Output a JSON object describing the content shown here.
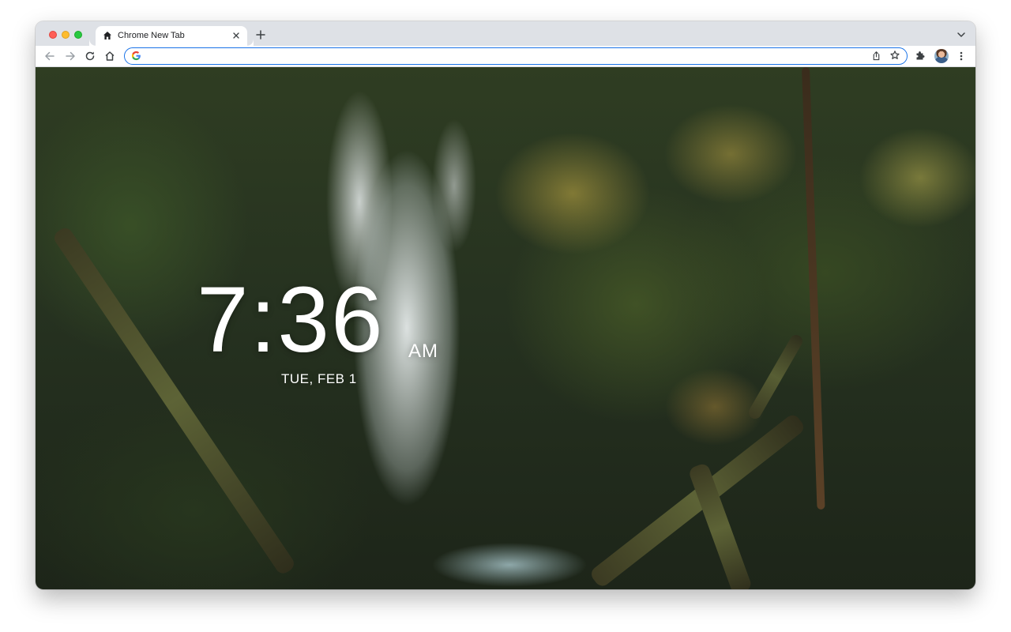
{
  "browser": {
    "tab": {
      "title": "Chrome New Tab",
      "icon": "home-icon"
    },
    "toolbar": {
      "back_icon": "arrow-left-icon",
      "forward_icon": "arrow-right-icon",
      "reload_icon": "reload-icon",
      "home_icon": "home-icon"
    },
    "omnibox": {
      "value": "",
      "placeholder": "",
      "search_engine_icon": "google-g-icon"
    },
    "accent_color": "#1a73e8"
  },
  "newtab": {
    "time": "7:36",
    "ampm": "AM",
    "date": "TUE, FEB 1",
    "background": "forest waterfall photo"
  }
}
